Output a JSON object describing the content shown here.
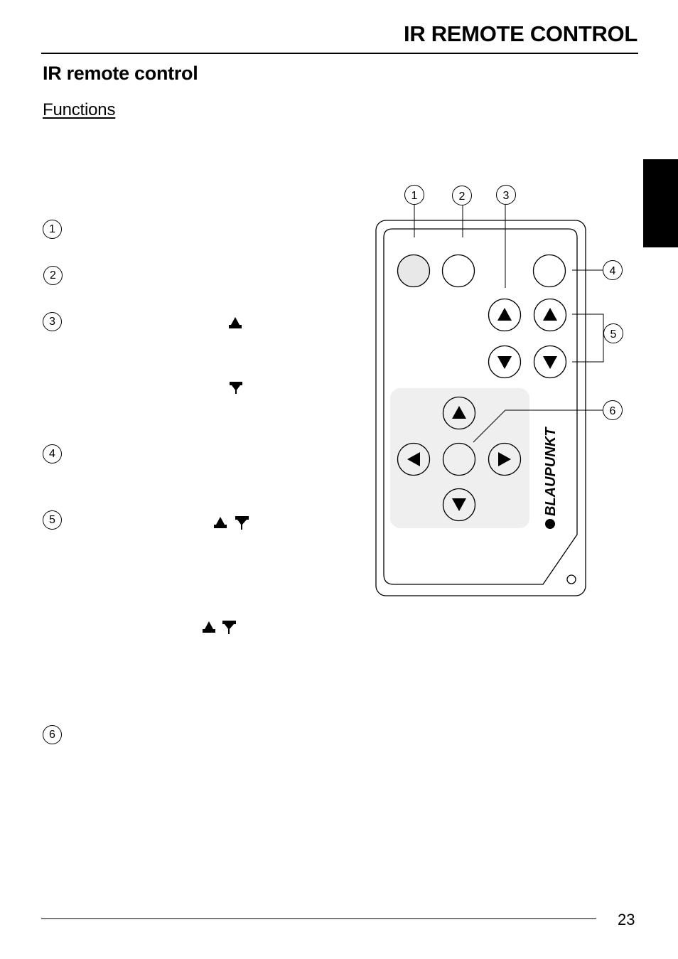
{
  "header": {
    "title": "IR REMOTE CONTROL"
  },
  "page": {
    "title": "IR remote control",
    "section": "Functions",
    "number": "23"
  },
  "function_markers": [
    {
      "number": "1"
    },
    {
      "number": "2"
    },
    {
      "number": "3",
      "glyphs": [
        "up-arrow",
        "down-arrow"
      ]
    },
    {
      "number": "4"
    },
    {
      "number": "5",
      "glyphs": [
        "up-down-arrows",
        "up-down-arrows"
      ]
    },
    {
      "number": "6"
    }
  ],
  "diagram": {
    "brand": "BLAUPUNKT",
    "callouts": [
      "1",
      "2",
      "3",
      "4",
      "5",
      "6"
    ],
    "colors": {
      "outline": "#000000",
      "pad": "#efefef",
      "button1": "#e8e8e8"
    }
  }
}
